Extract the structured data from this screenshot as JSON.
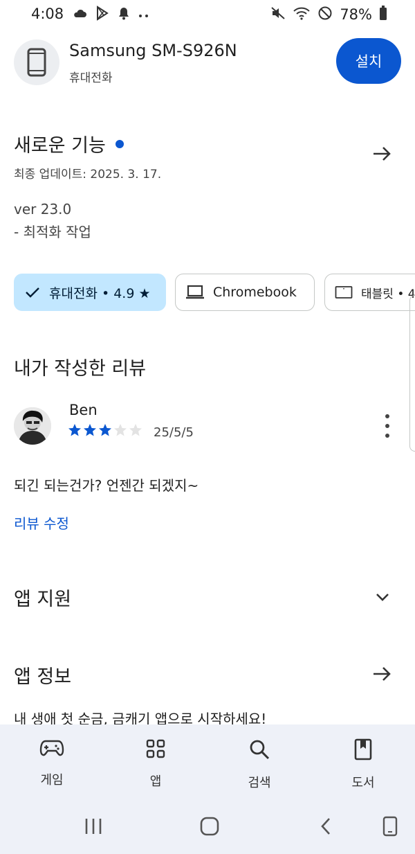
{
  "status_bar": {
    "time": "4:08",
    "battery": "78%"
  },
  "device": {
    "name": "Samsung SM-S926N",
    "type": "휴대전화",
    "install_label": "설치",
    "icon": "phone-icon"
  },
  "whats_new": {
    "title": "새로운 기능",
    "updated": "최종 업데이트: 2025. 3. 17.",
    "version": "ver 23.0",
    "note": "- 최적화 작업"
  },
  "chips": {
    "phone": "휴대전화 • 4.9 ★",
    "chromebook": "Chromebook",
    "tablet": "태블릿 • 4"
  },
  "reviews": {
    "title": "내가 작성한 리뷰",
    "author": "Ben",
    "rating": 3,
    "max_rating": 5,
    "date": "25/5/5",
    "text": "되긴 되는건가? 언젠간 되겠지~",
    "edit_label": "리뷰 수정"
  },
  "app_support": {
    "title": "앱 지원"
  },
  "app_info": {
    "title": "앱 정보",
    "description": "내 생애 첫 순금, 금캐기 앱으로 시작하세요!"
  },
  "bottom_nav": {
    "items": [
      {
        "label": "게임",
        "icon": "gamepad-icon"
      },
      {
        "label": "앱",
        "icon": "apps-grid-icon"
      },
      {
        "label": "검색",
        "icon": "search-icon"
      },
      {
        "label": "도서",
        "icon": "book-icon"
      }
    ]
  },
  "colors": {
    "accent": "#0b57d0",
    "chip_selected": "#c2e7ff",
    "nav_background": "#eef1f8"
  }
}
